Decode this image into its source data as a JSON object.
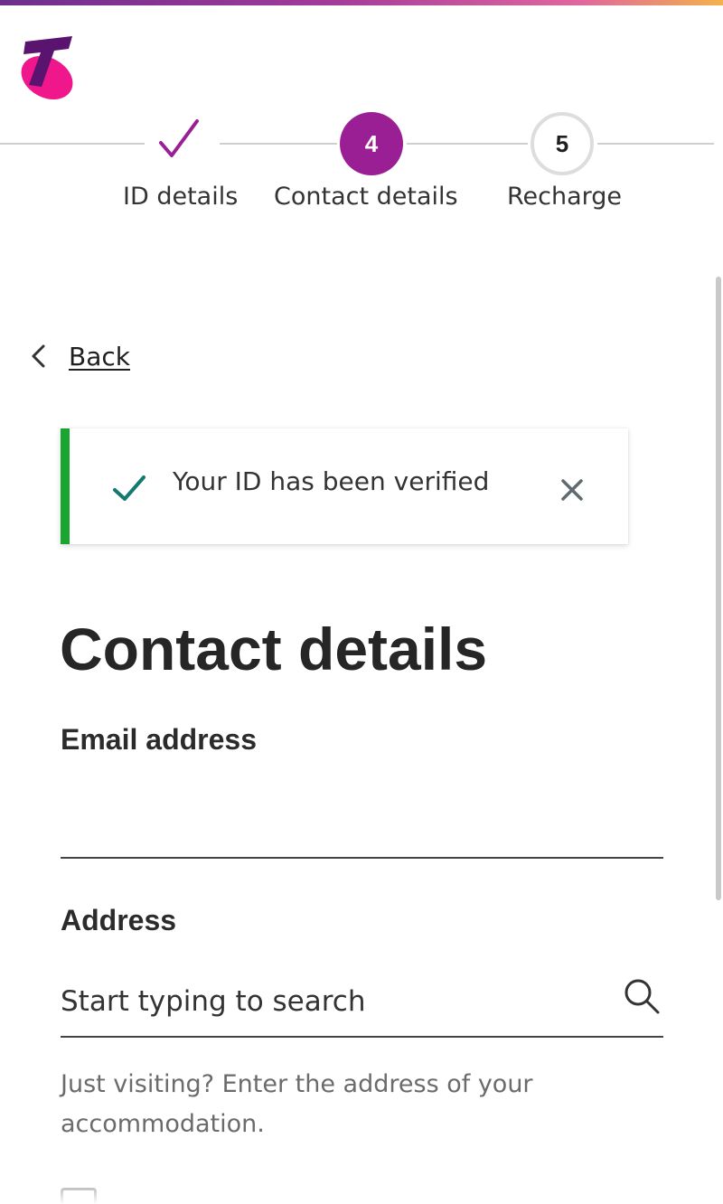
{
  "brand": {
    "logo_icon": "telstra-t-logo",
    "primary_color": "#9a1f95",
    "success_color": "#1aa531"
  },
  "stepper": {
    "completed": {
      "icon": "check-icon",
      "label": "ID details"
    },
    "current": {
      "number": "4",
      "label": "Contact details"
    },
    "next": {
      "number": "5",
      "label": "Recharge"
    }
  },
  "nav": {
    "back_label": "Back",
    "back_icon": "chevron-left-icon"
  },
  "alert": {
    "message": "Your ID has been verified",
    "status_icon": "check-icon",
    "close_icon": "close-icon"
  },
  "page": {
    "title": "Contact details"
  },
  "form": {
    "email": {
      "label": "Email address",
      "value": ""
    },
    "address": {
      "label": "Address",
      "value": "",
      "placeholder": "Start typing to search",
      "icon": "search-icon",
      "help_text": "Just visiting? Enter the address of your accommodation."
    },
    "checkbox": {
      "checked": false
    }
  }
}
